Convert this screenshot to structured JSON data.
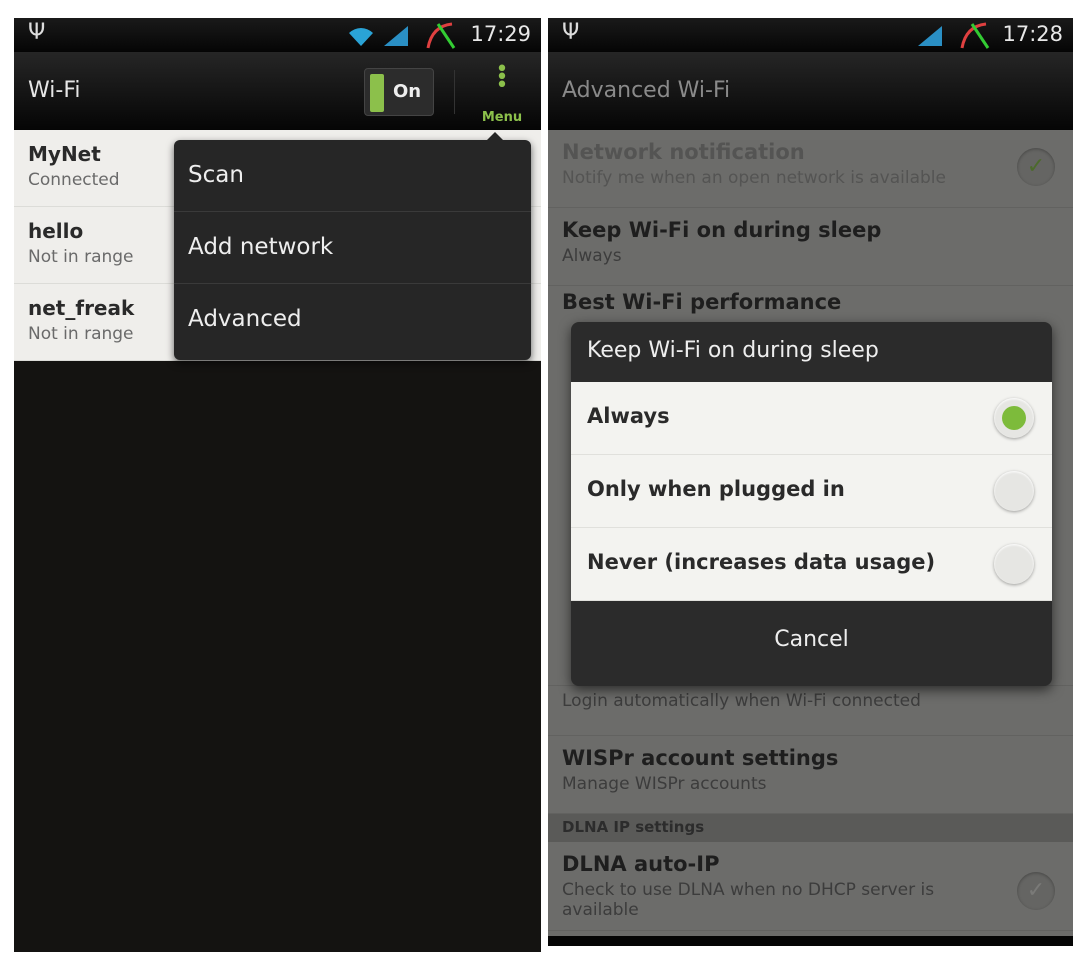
{
  "left": {
    "status": {
      "time": "17:29",
      "icons": [
        "usb-icon",
        "wifi-icon",
        "signal-icon",
        "gauge-icon"
      ]
    },
    "title": "Wi-Fi",
    "toggle": {
      "label": "On",
      "state": true
    },
    "menu_label": "Menu",
    "networks": [
      {
        "name": "MyNet",
        "status": "Connected"
      },
      {
        "name": "hello",
        "status": "Not in range"
      },
      {
        "name": "net_freak",
        "status": "Not in range"
      }
    ],
    "menu_items": [
      "Scan",
      "Add network",
      "Advanced"
    ]
  },
  "right": {
    "status": {
      "time": "17:28",
      "icons": [
        "usb-icon",
        "signal-icon",
        "gauge-icon"
      ]
    },
    "title": "Advanced Wi-Fi",
    "settings": [
      {
        "title": "Network notification",
        "summary": "Notify me when an open network is available",
        "checked": true,
        "disabled": true
      },
      {
        "title": "Keep Wi-Fi on during sleep",
        "summary": "Always"
      },
      {
        "title": "Best Wi-Fi performance",
        "summary": ""
      }
    ],
    "lower_settings": [
      {
        "title": "",
        "summary": "Login automatically when Wi-Fi connected"
      },
      {
        "title": "WISPr account settings",
        "summary": "Manage WISPr accounts"
      }
    ],
    "section": "DLNA IP settings",
    "dlna": {
      "title": "DLNA auto-IP",
      "summary": "Check to use DLNA when no DHCP server is available",
      "checked": false
    },
    "dialog": {
      "title": "Keep Wi-Fi on during sleep",
      "options": [
        "Always",
        "Only when plugged in",
        "Never (increases data usage)"
      ],
      "selected": "Always",
      "cancel": "Cancel"
    }
  },
  "colors": {
    "accent": "#8cc04b",
    "radio_selected": "#7dbb3b"
  }
}
